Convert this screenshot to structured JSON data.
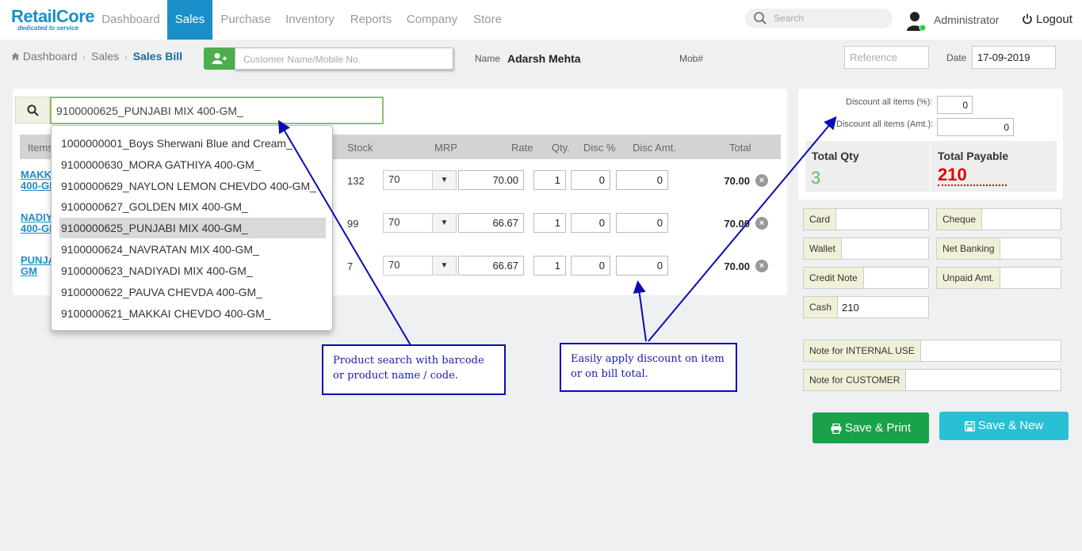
{
  "app": {
    "logo": "RetailCore",
    "tagline": "dedicated to service"
  },
  "nav": {
    "items": [
      "Dashboard",
      "Sales",
      "Purchase",
      "Inventory",
      "Reports",
      "Company",
      "Store"
    ],
    "active": "Sales",
    "search_placeholder": "Search",
    "user": "Administrator",
    "logout": "Logout"
  },
  "breadcrumb": [
    "Dashboard",
    "Sales",
    "Sales Bill"
  ],
  "customer": {
    "input_placeholder": "Customer Name/Mobile No.",
    "name_label": "Name",
    "name_value": "Adarsh Mehta",
    "mob_label": "Mob#",
    "reference_placeholder": "Reference",
    "date_label": "Date",
    "date_value": "17-09-2019"
  },
  "product_search": {
    "value": "9100000625_PUNJABI MIX 400-GM_"
  },
  "table": {
    "headers": {
      "items": "Items",
      "stock": "Stock",
      "mrp": "MRP",
      "rate": "Rate",
      "qty": "Qty.",
      "disc_pct": "Disc %",
      "disc_amt": "Disc Amt.",
      "total": "Total"
    },
    "rows": [
      {
        "name1": "MAKK",
        "name2": "400-GM",
        "stock": "132",
        "mrp": "70",
        "rate": "70.00",
        "qty": "1",
        "disc_pct": "0",
        "disc_amt": "0",
        "total": "70.00"
      },
      {
        "name1": "NADIY",
        "name2": "400-GM",
        "stock": "99",
        "mrp": "70",
        "rate": "66.67",
        "qty": "1",
        "disc_pct": "0",
        "disc_amt": "0",
        "total": "70.00"
      },
      {
        "name1": "PUNJA",
        "name2": "GM",
        "stock": "7",
        "mrp": "70",
        "rate": "66.67",
        "qty": "1",
        "disc_pct": "0",
        "disc_amt": "0",
        "total": "70.00"
      }
    ]
  },
  "dropdown": {
    "items": [
      "1000000001_Boys Sherwani Blue and Cream_",
      "9100000630_MORA GATHIYA 400-GM_",
      "9100000629_NAYLON LEMON CHEVDO 400-GM_",
      "9100000627_GOLDEN MIX 400-GM_",
      "9100000625_PUNJABI MIX 400-GM_",
      "9100000624_NAVRATAN MIX 400-GM_",
      "9100000623_NADIYADI MIX 400-GM_",
      "9100000622_PAUVA CHEVDA 400-GM_",
      "9100000621_MAKKAI CHEVDO 400-GM_"
    ],
    "highlighted_index": 4
  },
  "callouts": {
    "search": "Product search with barcode or product name / code.",
    "discount": "Easily apply discount on item or on bill total."
  },
  "summary": {
    "disc_pct_label": "Discount all items (%):",
    "disc_pct_value": "0",
    "disc_amt_label": "Discount all items (Amt.):",
    "disc_amt_value": "0",
    "total_qty_label": "Total Qty",
    "total_qty_value": "3",
    "total_payable_label": "Total Payable",
    "total_payable_value": "210"
  },
  "payments": {
    "card": "Card",
    "cheque": "Cheque",
    "wallet": "Wallet",
    "net_banking": "Net Banking",
    "credit_note": "Credit Note",
    "unpaid": "Unpaid Amt.",
    "cash": "Cash",
    "cash_value": "210"
  },
  "notes": {
    "internal": "Note for INTERNAL USE",
    "customer": "Note for CUSTOMER"
  },
  "buttons": {
    "save_print": "Save & Print",
    "save_new": "Save & New"
  },
  "colors": {
    "brand": "#1a8fc9",
    "save_print": "#1aa24a",
    "save_new": "#29c0d6",
    "payable": "#e00000",
    "qty": "#5cb85c",
    "callout": "#0b0bb5"
  }
}
